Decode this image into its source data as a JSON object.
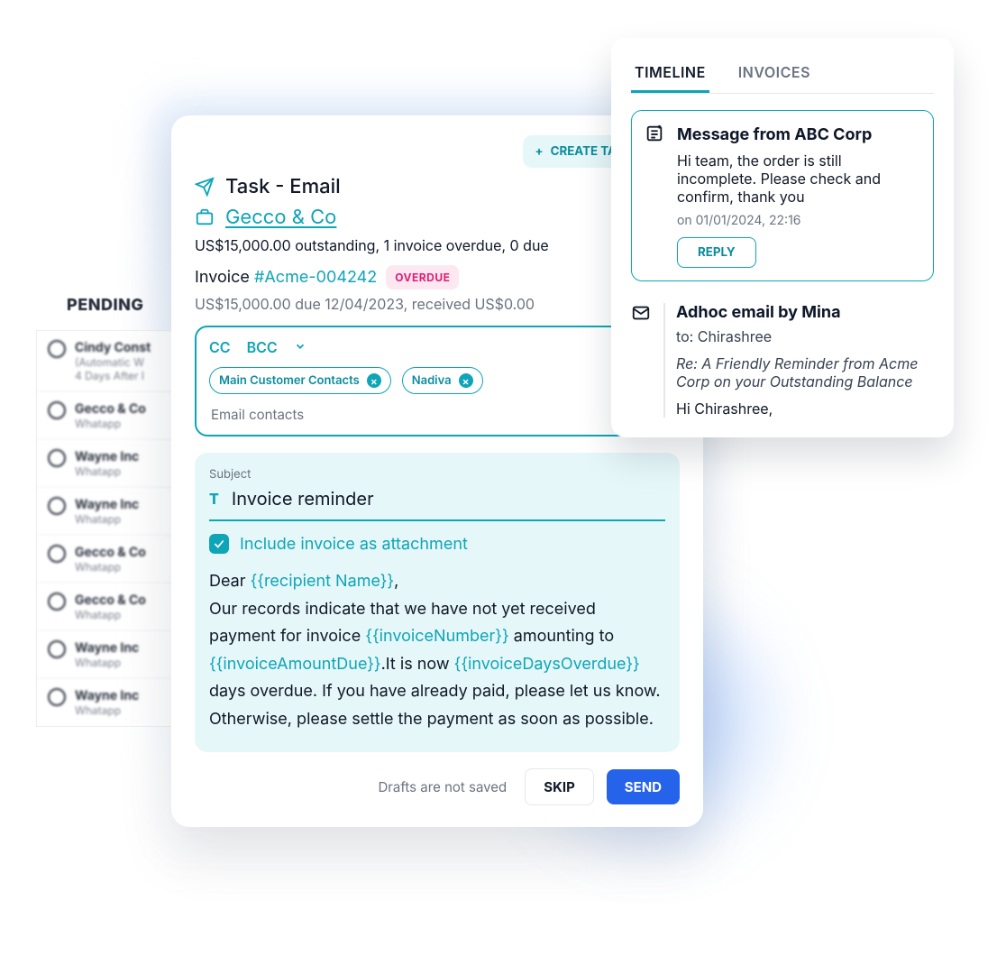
{
  "pending": {
    "label": "PENDING",
    "channel_label": "Whatapp",
    "items": [
      {
        "title": "Cindy Const",
        "subtitle": "(Automatic W",
        "subtitle2": "4 Days After I"
      },
      {
        "title": "Gecco & Co"
      },
      {
        "title": "Wayne Inc"
      },
      {
        "title": "Wayne Inc"
      },
      {
        "title": "Gecco & Co"
      },
      {
        "title": "Gecco & Co"
      },
      {
        "title": "Wayne Inc"
      },
      {
        "title": "Wayne Inc"
      }
    ]
  },
  "task": {
    "create_label": "CREATE TASK",
    "title": "Task - Email",
    "company": "Gecco & Co",
    "summary": "US$15,000.00 outstanding, 1 invoice overdue, 0 due",
    "invoice_prefix": "Invoice ",
    "invoice_link": "#Acme-004242",
    "overdue_badge": "OVERDUE",
    "due_line": "US$15,000.00 due 12/04/2023, received US$0.00",
    "cc": "CC",
    "bcc": "BCC",
    "chip1": "Main Customer Contacts",
    "chip2": "Nadiva",
    "contacts_placeholder": "Email contacts",
    "subject_label": "Subject",
    "subject_value": "Invoice reminder",
    "attach_label": "Include invoice as attachment",
    "body": {
      "dear": "Dear ",
      "var_recipient": "{{recipient Name}}",
      "comma": ",",
      "line1": "Our records indicate that we have not yet received payment for invoice ",
      "var_invno": "{{invoiceNumber}}",
      "mid1": " amounting to ",
      "var_amount": "{{invoiceAmountDue}}",
      "mid2": ".It is now ",
      "var_days": "{{invoiceDaysOverdue}}",
      "line2": " days overdue. If you have already paid, please let us know. Otherwise, please settle the payment as soon as possible."
    },
    "drafts_hint": "Drafts are not saved",
    "skip": "SKIP",
    "send": "SEND"
  },
  "timeline": {
    "tab_active": "TIMELINE",
    "tab_inactive": "INVOICES",
    "event1": {
      "title": "Message from ABC Corp",
      "body": "Hi team, the order is still incomplete. Please check and confirm, thank you",
      "ts": "on 01/01/2024, 22:16",
      "reply": "REPLY"
    },
    "event2": {
      "title": "Adhoc email by Mina",
      "to": "to: Chirashree",
      "subject": "Re: A Friendly Reminder from Acme Corp on your Outstanding Balance",
      "greeting": "Hi Chirashree,"
    }
  }
}
